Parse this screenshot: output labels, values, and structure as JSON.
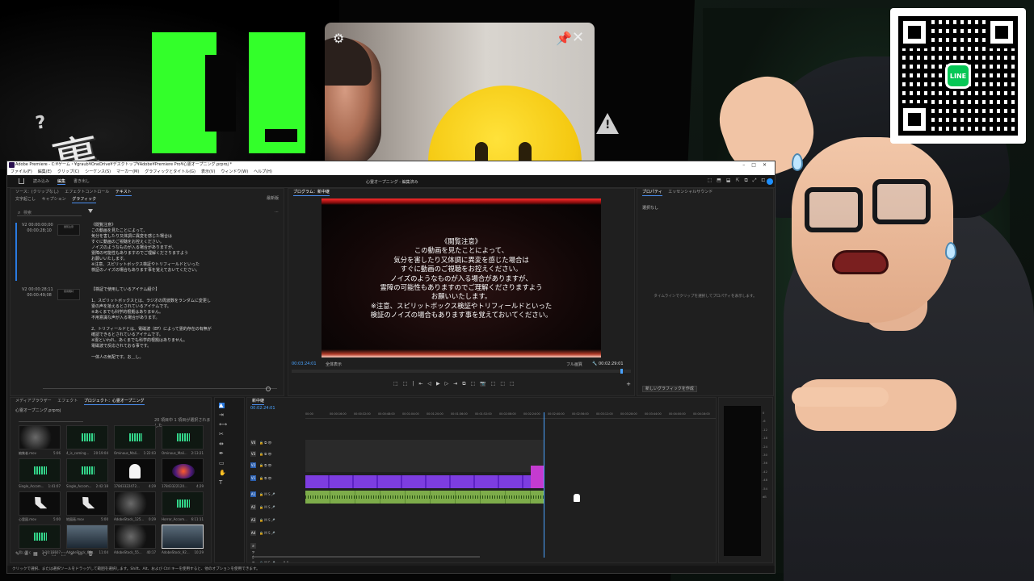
{
  "overlay": {
    "glitch_title": "KI",
    "kanji": "裏",
    "question_mark": "?"
  },
  "qr": {
    "badge": "LINE"
  },
  "premiere": {
    "title": "Adobe Premiere - C:¥ゲーム・¥graub¥OneDrive¥デスクトップ¥Adobe¥Premiere Pro¥心霊オープニング.prproj *",
    "menu": [
      "ファイル(F)",
      "編集(E)",
      "クリップ(C)",
      "シーケンス(S)",
      "マーカー(M)",
      "グラフィックとタイトル(G)",
      "表示(V)",
      "ウィンドウ(W)",
      "ヘルプ(H)"
    ],
    "workspace_tabs": [
      "読み込み",
      "編集",
      "書き出し"
    ],
    "sequence_title": "心霊オープニング - 編集済み",
    "text_panel": {
      "tabs": [
        "ソース：(クリップなし)",
        "エフェクトコントロール",
        "テキスト"
      ],
      "subtabs": [
        "文字起こし",
        "キャプション",
        "グラフィック"
      ],
      "right_label": "最新版",
      "search_placeholder": "検索",
      "blocks": [
        {
          "track": "V2",
          "tc_in": "00:00:00;00",
          "tc_out": "00:00:28;10",
          "thumb": "閲覧注意",
          "lines": "《閲覧注意》\nこの動画を見たことによって、\n気分を害したり又体調に異変を感じた場合は\nすぐに動画のご視聴をお控えください。\nノイズのようなものが入る場合がありますが、\n霊障の可能性もありますのでご理解くださりますよう\nお願いいたします。\n※注意、スピリットボックス検証やトリフィールドといった\n検証のノイズの場合もあります事を覚えておいてください。"
        },
        {
          "track": "V2",
          "tc_in": "00:00:28;11",
          "tc_out": "00:00:49;08",
          "thumb": "使用機材",
          "lines": "【検証で使用しているアイテム紹介】\n\n1、スピリットボックスとは、ラジオの周波数をランダムに変更し\n霊の声を拾えるとされているアイテムです。\n※あくまでも科学的根拠はありません。\n不用意識な声が入る場合があります。\n\n2、トリフィールドとは、電磁波（EF）によって霊的存在の有無が\n確認できるとされているアイテムです。\n※霊といわれ、あくまでも科学的根拠はありません。\n電磁波で反応されておる事です。\n\n一体人の気配です。お＿し。"
        }
      ]
    },
    "program": {
      "tab": "プログラム：新中継",
      "video_text": "《閲覧注意》\nこの動画を見たことによって、\n気分を害したり又体調に異変を感じた場合は\nすぐに動画のご視聴をお控えください。\nノイズのようなものが入る場合がありますが、\n霊障の可能性もありますのでご理解くださりますよう\nお願いいたします。\n※注意、スピリットボックス検証やトリフィールドといった\n検証のノイズの場合もあります事を覚えておいてください。",
      "tc_current": "00:03:24:01",
      "fit": "全体表示",
      "quality": "フル画質",
      "tc_total": "00:02:29:01",
      "playhead_fraction": 0.97
    },
    "properties": {
      "tabs": [
        "プロパティ",
        "エッセンシャルサウンド"
      ],
      "sub": "選択なし",
      "empty_message": "タイムラインでクリップを選択してプロパティを表示します。",
      "new_graphic": "新しいグラフィックを作成"
    },
    "project": {
      "tabs": [
        "メディアブラウザー",
        "エフェクト",
        "プロジェクト：心霊オープニング"
      ],
      "path": "心霊オープニング.prproj",
      "count": "20 項目中 1 項目が選択されました",
      "items": [
        {
          "label": "編集者.mov",
          "dur": "5:06",
          "kind": "dark"
        },
        {
          "label": "4_is_coming...",
          "dur": "20:19:04",
          "kind": "audio"
        },
        {
          "label": "Ominous_Mali...",
          "dur": "1:22:03",
          "kind": "audio"
        },
        {
          "label": "Ominous_Mali...",
          "dur": "2:13:21",
          "kind": "audio"
        },
        {
          "label": "Single_Accom...",
          "dur": "1:41:07",
          "kind": "audio"
        },
        {
          "label": "Single_Accom...",
          "dur": "2:42:18",
          "kind": "audio"
        },
        {
          "label": "17843322472...",
          "dur": "4:29",
          "kind": "ghost"
        },
        {
          "label": "17843322120...",
          "dur": "4:29",
          "kind": "logo"
        },
        {
          "label": "心霊図.mov",
          "dur": "5:00",
          "kind": "map"
        },
        {
          "label": "地図画.mov",
          "dur": "5:00",
          "kind": "map"
        },
        {
          "label": "AdobeStock_125...",
          "dur": "0:29",
          "kind": "dark"
        },
        {
          "label": "Horror_Accom...",
          "dur": "6:11:11",
          "kind": "audio"
        },
        {
          "label": "男い驚く",
          "dur": "2:10:15507",
          "kind": "audio"
        },
        {
          "label": "AdobeStock_69...",
          "dur": "11:04",
          "kind": "forest"
        },
        {
          "label": "AdobeStock_55...",
          "dur": "40:17",
          "kind": "dark"
        },
        {
          "label": "AdobeStock_92...",
          "dur": "10:29",
          "kind": "forest",
          "selected": true
        }
      ]
    },
    "timeline": {
      "tab": "新中継",
      "tc": "00:02:24:01",
      "ruler": [
        "00:00",
        "00:00:16:00",
        "00:00:32:00",
        "00:00:48:00",
        "00:01:04:00",
        "00:01:20:00",
        "00:01:36:00",
        "00:01:52:00",
        "00:02:08:00",
        "00:02:24:00",
        "00:02:40:00",
        "00:02:56:00",
        "00:03:12:00",
        "00:03:28:00",
        "00:03:44:00",
        "00:04:00:00",
        "00:04:16:00"
      ],
      "tracks": [
        "V4",
        "V3",
        "V2",
        "V1",
        "A1",
        "A2",
        "A3",
        "A4",
        "ミックス"
      ],
      "mix_value": "0.0"
    },
    "meter": {
      "scale": "0\n-6\n-12\n-18\n-24\n-30\n-36\n-42\n-48\n-54\ndB"
    },
    "status": "クリックで選択、または選択ツールをドラッグして範囲を選択します。Shift、Alt、および Ctrl キーを使用すると、他のオプションを使用できます。"
  }
}
